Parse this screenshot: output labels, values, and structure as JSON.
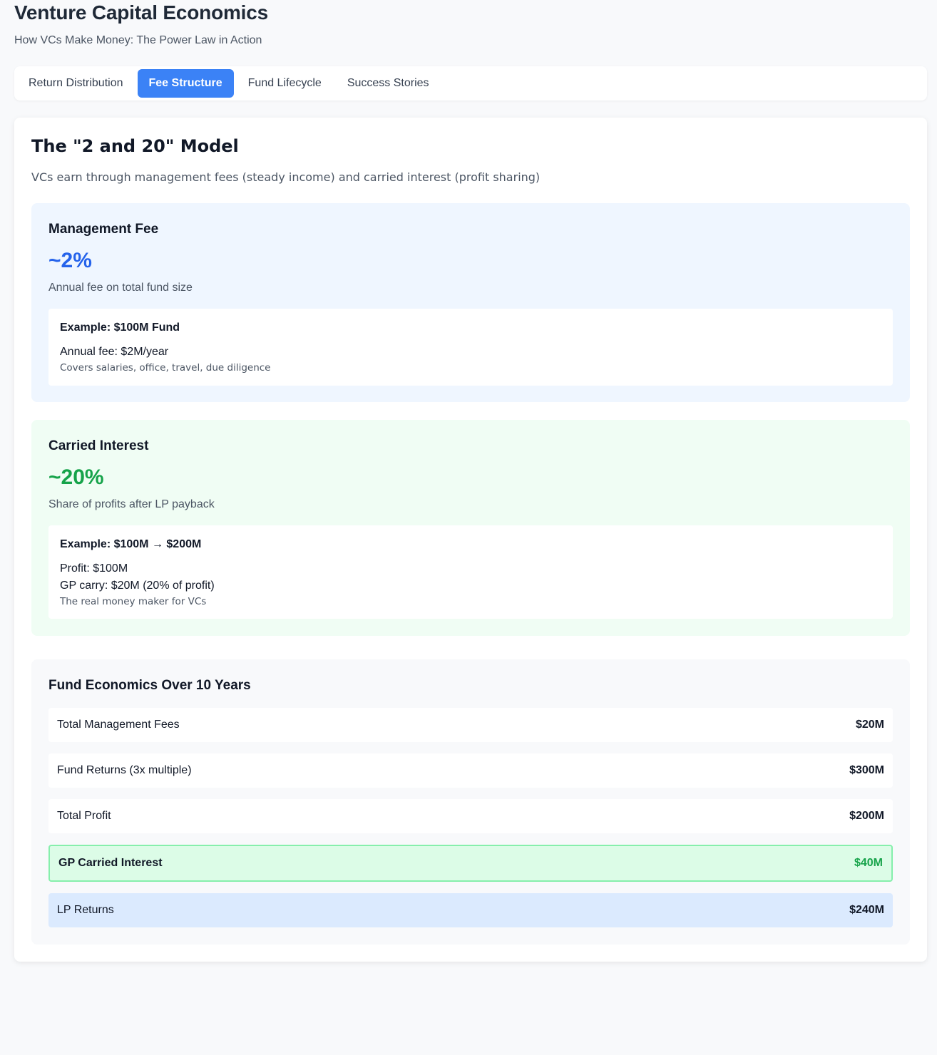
{
  "header": {
    "title": "Venture Capital Economics",
    "subtitle": "How VCs Make Money: The Power Law in Action"
  },
  "tabs": [
    {
      "label": "Return Distribution",
      "active": false
    },
    {
      "label": "Fee Structure",
      "active": true
    },
    {
      "label": "Fund Lifecycle",
      "active": false
    },
    {
      "label": "Success Stories",
      "active": false
    }
  ],
  "panel": {
    "title": "The \"2 and 20\" Model",
    "description": "VCs earn through management fees (steady income) and carried interest (profit sharing)"
  },
  "management_fee": {
    "title": "Management Fee",
    "percent": "~2%",
    "description": "Annual fee on total fund size",
    "example_title": "Example: $100M Fund",
    "example_lines": [
      "Annual fee: $2M/year"
    ],
    "example_note": "Covers salaries, office, travel, due diligence"
  },
  "carried_interest": {
    "title": "Carried Interest",
    "percent": "~20%",
    "description": "Share of profits after LP payback",
    "example_title": "Example: $100M → $200M",
    "example_lines": [
      "Profit: $100M",
      "GP carry: $20M (20% of profit)"
    ],
    "example_note": "The real money maker for VCs"
  },
  "economics": {
    "title": "Fund Economics Over 10 Years",
    "rows": [
      {
        "label": "Total Management Fees",
        "value": "$20M"
      },
      {
        "label": "Fund Returns (3x multiple)",
        "value": "$300M"
      },
      {
        "label": "Total Profit",
        "value": "$200M"
      },
      {
        "label": "GP Carried Interest",
        "value": "$40M"
      },
      {
        "label": "LP Returns",
        "value": "$240M"
      }
    ]
  },
  "colors": {
    "accent": "#3b82f6",
    "management_bg": "#eff6ff",
    "management_value": "#2563eb",
    "carry_bg": "#f0fdf4",
    "carry_value": "#16a34a",
    "gp_row_bg": "#dcfce7",
    "lp_row_bg": "#dbeafe"
  }
}
